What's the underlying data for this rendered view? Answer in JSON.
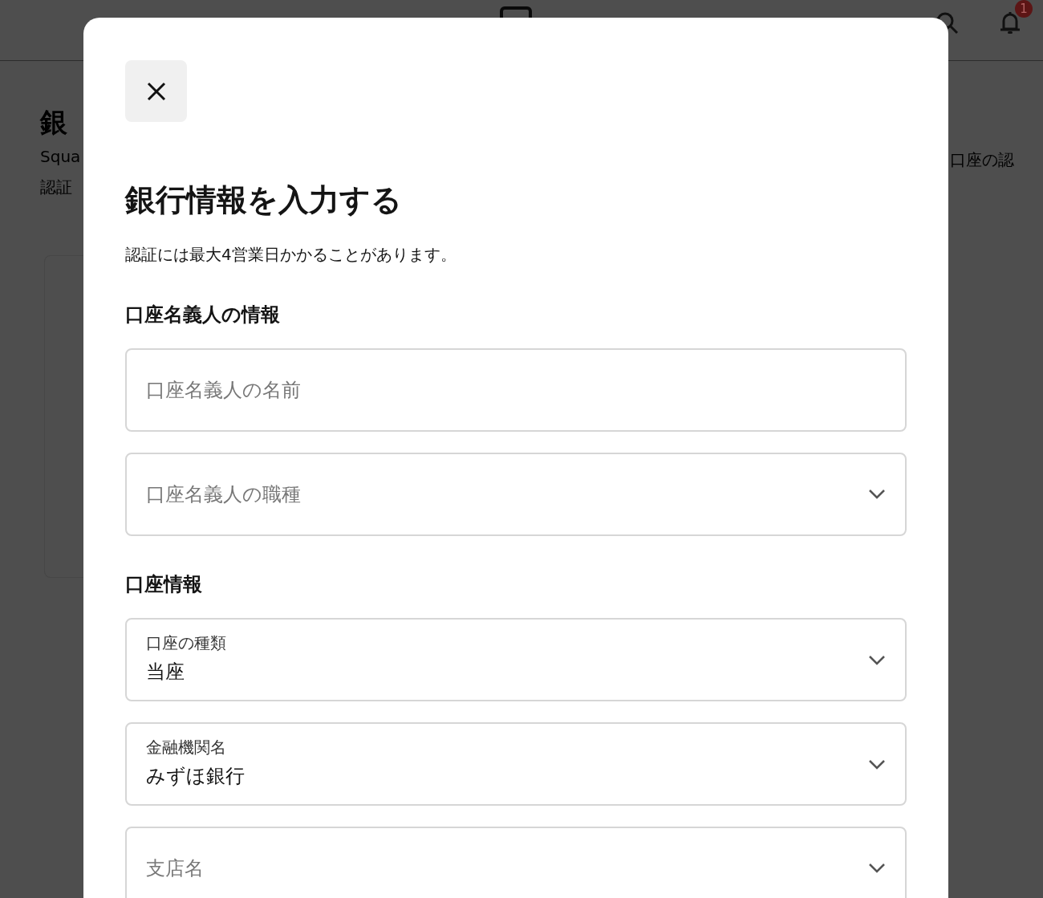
{
  "background": {
    "notification_count": "1",
    "title": "銀",
    "description_lines": [
      "Squa",
      "認証"
    ],
    "right_text": "口座の認"
  },
  "modal": {
    "title": "銀行情報を入力する",
    "subtitle": "認証には最大4営業日かかることがあります。",
    "sections": [
      {
        "heading": "口座名義人の情報",
        "fields": [
          {
            "kind": "text",
            "placeholder": "口座名義人の名前"
          },
          {
            "kind": "select",
            "placeholder": "口座名義人の職種"
          }
        ]
      },
      {
        "heading": "口座情報",
        "fields": [
          {
            "kind": "select",
            "label": "口座の種類",
            "value": "当座"
          },
          {
            "kind": "select",
            "label": "金融機関名",
            "value": "みずほ銀行"
          },
          {
            "kind": "select",
            "placeholder": "支店名"
          }
        ]
      }
    ]
  }
}
